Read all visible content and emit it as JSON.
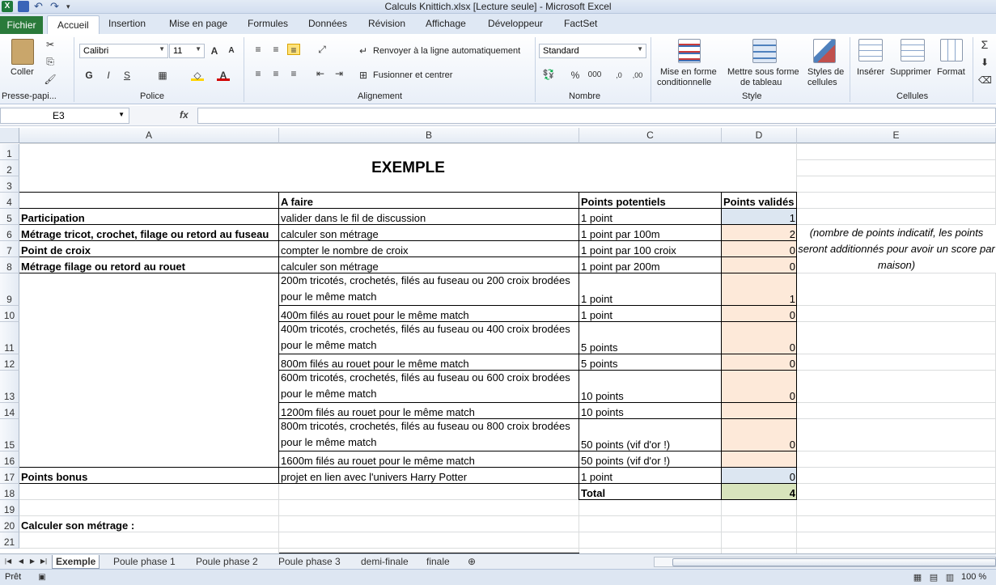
{
  "window": {
    "title": "Calculs Knittich.xlsx  [Lecture seule]  -  Microsoft Excel"
  },
  "tabs": {
    "file": "Fichier",
    "items": [
      "Accueil",
      "Insertion",
      "Mise en page",
      "Formules",
      "Données",
      "Révision",
      "Affichage",
      "Développeur",
      "FactSet"
    ]
  },
  "ribbon": {
    "clipboard": {
      "paste": "Coller",
      "label": "Presse-papi..."
    },
    "font": {
      "name": "Calibri",
      "size": "11",
      "bold": "G",
      "italic": "I",
      "underline": "S",
      "label": "Police"
    },
    "alignment": {
      "wrap": "Renvoyer à la ligne automatiquement",
      "merge": "Fusionner et centrer",
      "label": "Alignement"
    },
    "number": {
      "format": "Standard",
      "percent": "%",
      "thousands": "000",
      "label": "Nombre"
    },
    "style": {
      "cond": "Mise en forme",
      "cond2": "conditionnelle",
      "table": "Mettre sous forme",
      "table2": "de tableau",
      "cell": "Styles de",
      "cell2": "cellules",
      "label": "Style"
    },
    "cells": {
      "insert": "Insérer",
      "delete": "Supprimer",
      "format": "Format",
      "label": "Cellules"
    }
  },
  "formula_bar": {
    "name_box": "E3",
    "fx": "fx",
    "value": ""
  },
  "columns": [
    "A",
    "B",
    "C",
    "D",
    "E"
  ],
  "rows": [
    "1",
    "2",
    "3",
    "4",
    "5",
    "6",
    "7",
    "8",
    "9",
    "10",
    "11",
    "12",
    "13",
    "14",
    "15",
    "16",
    "17",
    "18",
    "19",
    "20",
    "21"
  ],
  "sheet": {
    "title": "EXEMPLE",
    "headers": {
      "b": "A faire",
      "c": "Points potentiels",
      "d": "Points validés"
    },
    "r5": {
      "a": "Participation",
      "b": "valider dans le fil de discussion",
      "c": "1 point",
      "d": "1"
    },
    "r6": {
      "a": "Métrage tricot, crochet, filage ou retord au fuseau",
      "b": "calculer son métrage",
      "c": "1 point par 100m",
      "d": "2"
    },
    "r7": {
      "a": "Point de croix",
      "b": "compter le nombre de croix",
      "c": "1 point par 100 croix",
      "d": "0"
    },
    "r8": {
      "a": "Métrage filage ou retord au rouet",
      "b": "calculer son métrage",
      "c": "1 point par 200m",
      "d": "0"
    },
    "r9": {
      "b": "200m tricotés, crochetés, filés au fuseau ou 200 croix brodées pour le même match",
      "c": "1 point",
      "d": "1"
    },
    "r10": {
      "b": "400m filés au rouet pour le même match",
      "c": "1 point",
      "d": "0"
    },
    "r11": {
      "b": "400m tricotés, crochetés, filés au fuseau ou 400 croix brodées pour le même match",
      "c": "5 points",
      "d": "0"
    },
    "r12": {
      "b": "800m filés au rouet pour le même match",
      "c": "5 points",
      "d": "0"
    },
    "r13": {
      "b": "600m tricotés, crochetés, filés au fuseau ou 600 croix brodées pour le même match",
      "c": "10 points",
      "d": "0"
    },
    "r14": {
      "b": "1200m filés au rouet pour le même match",
      "c": "10 points",
      "d": ""
    },
    "r15": {
      "b": "800m tricotés, crochetés, filés au fuseau ou 800 croix brodées pour le même match",
      "c": "50 points (vif d'or !)",
      "d": "0"
    },
    "r16": {
      "b": "1600m filés au rouet pour le même match",
      "c": "50 points (vif d'or !)",
      "d": ""
    },
    "r17": {
      "a": "Points bonus",
      "b": "projet en lien avec l'univers Harry Potter",
      "c": "1 point",
      "d": "0"
    },
    "r18": {
      "c": "Total",
      "d": "4"
    },
    "note": "(nombre de points indicatif, les points seront additionnés pour avoir un score par maison)",
    "r20": {
      "a": "Calculer son métrage :"
    }
  },
  "sheet_tabs": [
    "Exemple",
    "Poule phase 1",
    "Poule phase 2",
    "Poule phase 3",
    "demi-finale",
    "finale"
  ],
  "status": {
    "ready": "Prêt",
    "zoom": "100 %"
  },
  "colors": {
    "blue_fill": "#dce6f1",
    "peach_fill": "#fde9d9",
    "green_fill": "#d8e4bc",
    "file_tab": "#2a7a3a"
  }
}
